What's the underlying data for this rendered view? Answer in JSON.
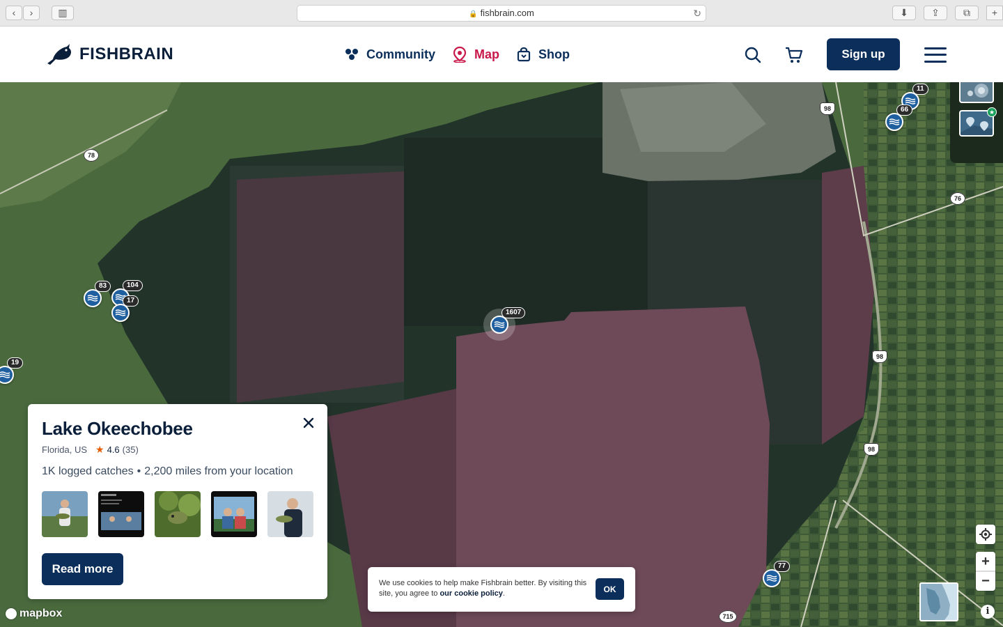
{
  "browser": {
    "url": "fishbrain.com",
    "back_icon": "chevron-left-icon",
    "forward_icon": "chevron-right-icon"
  },
  "header": {
    "logo_text": "FISHBRAIN",
    "nav": [
      {
        "label": "Community",
        "icon": "community-icon",
        "active": false
      },
      {
        "label": "Map",
        "icon": "map-pin-icon",
        "active": true
      },
      {
        "label": "Shop",
        "icon": "shopping-bag-icon",
        "active": false
      }
    ],
    "signup_label": "Sign up",
    "colors": {
      "brand": "#0b2e5a",
      "active": "#c9184a"
    }
  },
  "map": {
    "pins": [
      {
        "count": "11"
      },
      {
        "count": "66"
      },
      {
        "count": "83"
      },
      {
        "count": "104"
      },
      {
        "count": "17"
      },
      {
        "count": "19"
      },
      {
        "count": "1607"
      },
      {
        "count": "77"
      }
    ],
    "roads": [
      "98",
      "78",
      "76",
      "98",
      "98",
      "715"
    ],
    "attribution": "mapbox"
  },
  "card": {
    "title": "Lake Okeechobee",
    "location": "Florida, US",
    "rating": "4.6",
    "rating_count": "(35)",
    "catches": "1K logged catches",
    "separator": "•",
    "distance": "2,200 miles from your location",
    "read_more_label": "Read more"
  },
  "cookie": {
    "text": "We use cookies to help make Fishbrain better. By visiting this site, you agree to",
    "link": "our cookie policy",
    "suffix": ".",
    "ok_label": "OK"
  },
  "controls": {
    "zoom_in": "+",
    "zoom_out": "−",
    "info": "i"
  }
}
